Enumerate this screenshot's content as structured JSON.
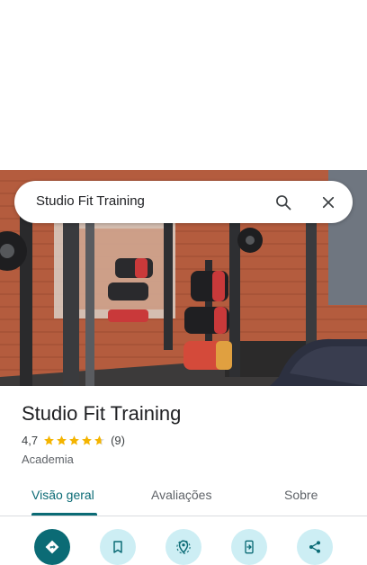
{
  "search": {
    "query": "Studio Fit Training"
  },
  "place": {
    "name": "Studio Fit Training",
    "rating": "4,7",
    "rating_value": 4.7,
    "reviews": "(9)",
    "category": "Academia"
  },
  "tabs": [
    {
      "label": "Visão geral",
      "active": true
    },
    {
      "label": "Avaliações",
      "active": false
    },
    {
      "label": "Sobre",
      "active": false
    }
  ],
  "actions": [
    {
      "icon": "directions-icon"
    },
    {
      "icon": "bookmark-icon"
    },
    {
      "icon": "nearby-icon"
    },
    {
      "icon": "send-to-phone-icon"
    },
    {
      "icon": "share-icon"
    }
  ],
  "colors": {
    "accent": "#0b6b75",
    "action_bg": "#cdeef4",
    "star": "#f4b400"
  }
}
